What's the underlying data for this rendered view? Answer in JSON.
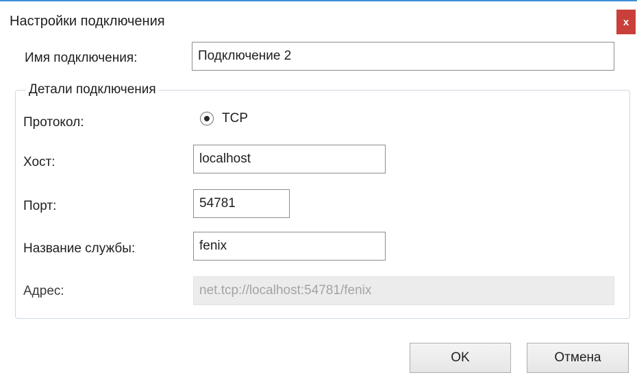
{
  "window": {
    "title": "Настройки подключения",
    "close_label": "x",
    "accent_color": "#3c8fd8",
    "close_color": "#c9403a"
  },
  "connection_name": {
    "label": "Имя подключения:",
    "value": "Подключение 2"
  },
  "details": {
    "group_label": "Детали подключения",
    "protocol": {
      "label": "Протокол:",
      "option_label": "TCP",
      "selected": true
    },
    "host": {
      "label": "Хост:",
      "value": "localhost"
    },
    "port": {
      "label": "Порт:",
      "value": "54781"
    },
    "service_name": {
      "label": "Название службы:",
      "value": "fenix"
    },
    "address": {
      "label": "Адрес:",
      "value": "net.tcp://localhost:54781/fenix"
    }
  },
  "buttons": {
    "ok_label": "OK",
    "cancel_label": "Отмена"
  }
}
